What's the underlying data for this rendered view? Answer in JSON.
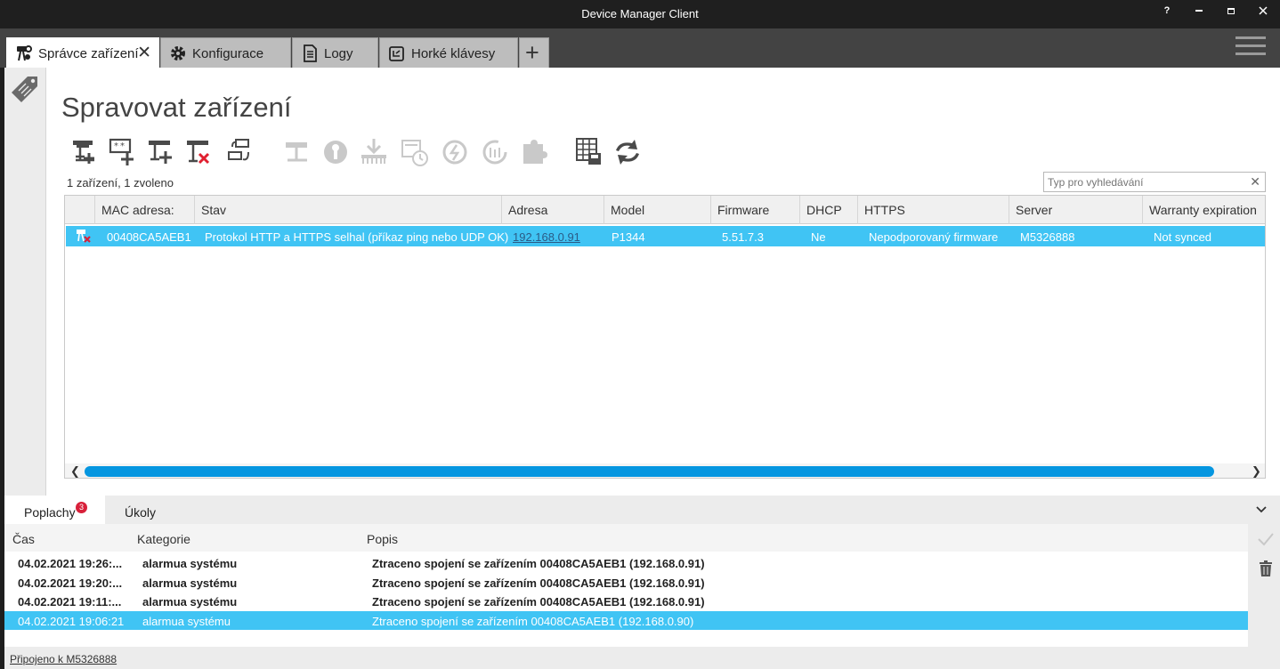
{
  "window": {
    "title": "Device Manager Client",
    "help_label": "?"
  },
  "tabs": [
    {
      "label": "Správce zařízení",
      "icon": "device-manager-icon",
      "active": true,
      "close": "✕"
    },
    {
      "label": "Konfigurace",
      "icon": "gear-icon"
    },
    {
      "label": "Logy",
      "icon": "log-document-icon"
    },
    {
      "label": "Horké klávesy",
      "icon": "keyboard-icon"
    }
  ],
  "add_tab": "+",
  "page": {
    "title": "Spravovat zařízení",
    "count": "1 zařízení, 1 zvoleno",
    "search_placeholder": "Typ pro vyhledávání",
    "search_clear": "✕"
  },
  "toolbar": [
    {
      "name": "add-device-icon",
      "enabled": true
    },
    {
      "name": "add-device-manually-icon",
      "enabled": true
    },
    {
      "name": "add-device-network-icon",
      "enabled": true
    },
    {
      "name": "remove-device-icon",
      "enabled": true
    },
    {
      "name": "assign-ip-icon",
      "enabled": true
    },
    {
      "name": "configure-device-icon",
      "enabled": false
    },
    {
      "name": "set-password-icon",
      "enabled": false
    },
    {
      "name": "upgrade-firmware-icon",
      "enabled": false
    },
    {
      "name": "date-time-icon",
      "enabled": false
    },
    {
      "name": "restart-icon",
      "enabled": false
    },
    {
      "name": "restore-defaults-icon",
      "enabled": false
    },
    {
      "name": "install-plugin-icon",
      "enabled": false
    },
    {
      "name": "export-table-icon",
      "enabled": true
    },
    {
      "name": "refresh-icon",
      "enabled": true
    }
  ],
  "device_table": {
    "columns": [
      "MAC adresa:",
      "Stav",
      "Adresa",
      "Model",
      "Firmware",
      "DHCP",
      "HTTPS",
      "Server",
      "Warranty expiration"
    ],
    "rows": [
      {
        "icon": "device-error-icon",
        "mac": "00408CA5AEB1",
        "status": "Protokol HTTP a HTTPS selhal (příkaz ping nebo UDP OK)",
        "address": "192.168.0.91",
        "model": "P1344",
        "firmware": "5.51.7.3",
        "dhcp": "Ne",
        "https": "Nepodporovaný firmware",
        "server": "M5326888",
        "warranty": "Not synced"
      }
    ]
  },
  "bottom_tabs": [
    {
      "label": "Poplachy",
      "badge": "3",
      "active": true
    },
    {
      "label": "Úkoly"
    }
  ],
  "alarms": {
    "columns": [
      "Čas",
      "Kategorie",
      "Popis"
    ],
    "rows": [
      {
        "time": "04.02.2021 19:26:...",
        "category": "alarmua systému",
        "description": "Ztraceno spojení se zařízením 00408CA5AEB1 (192.168.0.91)",
        "selected": false
      },
      {
        "time": "04.02.2021 19:20:...",
        "category": "alarmua systému",
        "description": "Ztraceno spojení se zařízením 00408CA5AEB1 (192.168.0.91)",
        "selected": false
      },
      {
        "time": "04.02.2021 19:11:...",
        "category": "alarmua systému",
        "description": "Ztraceno spojení se zařízením 00408CA5AEB1 (192.168.0.91)",
        "selected": false
      },
      {
        "time": "04.02.2021 19:06:21",
        "category": "alarmua systému",
        "description": "Ztraceno spojení se zařízením 00408CA5AEB1 (192.168.0.90)",
        "selected": true
      }
    ]
  },
  "status_bar": "Připojeno k M5326888",
  "colors": {
    "selection": "#40c4f4",
    "scroll_thumb": "#0596e0",
    "badge": "#d8203a"
  }
}
